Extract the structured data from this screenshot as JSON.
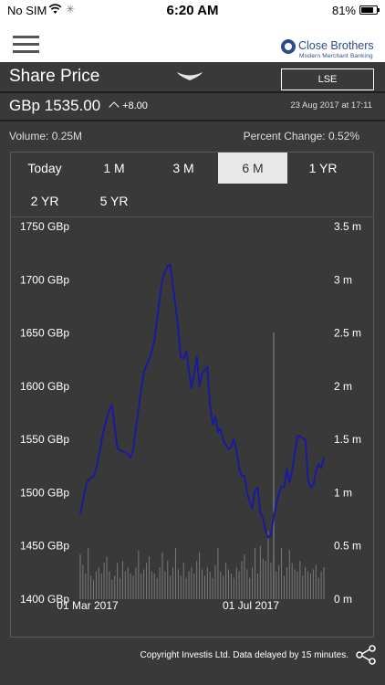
{
  "status_bar": {
    "carrier": "No SIM",
    "wifi_icon": "wifi-icon",
    "activity_icon": "loading-spinner-icon",
    "time": "6:20 AM",
    "battery": "81%",
    "battery_level": 0.81
  },
  "app_bar": {
    "menu_icon": "hamburger-menu-icon",
    "brand_name": "Close Brothers",
    "brand_tagline": "Modern Merchant Banking",
    "brand_color": "#2b4d8c"
  },
  "header": {
    "title": "Share Price",
    "collapse_icon": "chevron-down-icon",
    "exchange": "LSE"
  },
  "quote": {
    "price": "GBp 1535.00",
    "change": "+8.00",
    "change_icon": "chevron-up-icon",
    "timestamp": "23 Aug 2017 at 17:11"
  },
  "stats": {
    "volume": "Volume: 0.25M",
    "percent_change": "Percent Change: 0.52%"
  },
  "range_tabs": [
    {
      "label": "Today",
      "active": false
    },
    {
      "label": "1 M",
      "active": false
    },
    {
      "label": "3 M",
      "active": false
    },
    {
      "label": "6 M",
      "active": true
    },
    {
      "label": "1 YR",
      "active": false
    },
    {
      "label": "2 YR",
      "active": false
    },
    {
      "label": "5 YR",
      "active": false
    }
  ],
  "chart_data": {
    "type": "line",
    "y_tick_labels": [
      "1750 GBp",
      "1700 GBp",
      "1650 GBp",
      "1600 GBp",
      "1550 GBp",
      "1500 GBp",
      "1450 GBp",
      "1400 GBp"
    ],
    "y2_tick_labels": [
      "3.5 m",
      "3 m",
      "2.5 m",
      "2 m",
      "1.5 m",
      "1 m",
      "0.5 m",
      "0 m"
    ],
    "x_tick_labels": [
      "01 Mar 2017",
      "01 Jul 2017"
    ],
    "ylim": [
      1400,
      1750
    ],
    "y2lim": [
      0,
      3.5
    ],
    "grid": false,
    "line_color": "#1a1a9e",
    "volume_color": "#7a7a7a",
    "series": [
      {
        "type": "line",
        "values": [
          1480,
          1492,
          1505,
          1512,
          1514,
          1515,
          1522,
          1535,
          1548,
          1560,
          1570,
          1578,
          1582,
          1562,
          1542,
          1540,
          1539,
          1538,
          1536,
          1533,
          1540,
          1560,
          1578,
          1597,
          1613,
          1620,
          1625,
          1633,
          1643,
          1663,
          1683,
          1700,
          1707,
          1713,
          1714,
          1693,
          1675,
          1653,
          1627,
          1626,
          1633,
          1615,
          1598,
          1612,
          1628,
          1600,
          1612,
          1615,
          1618,
          1582,
          1564,
          1572,
          1557,
          1560,
          1549,
          1545,
          1541,
          1543,
          1550,
          1540,
          1523,
          1515,
          1516,
          1500,
          1491,
          1485,
          1502,
          1505,
          1481,
          1476,
          1464,
          1458,
          1460,
          1477,
          1490,
          1499,
          1506,
          1505,
          1522,
          1510,
          1520,
          1537,
          1553,
          1553,
          1551,
          1550,
          1512,
          1505,
          1507,
          1520,
          1527,
          1523,
          1533
        ]
      }
    ],
    "volume_values": [
      0.42,
      0.32,
      0.24,
      0.48,
      0.22,
      0.18,
      0.26,
      0.3,
      0.24,
      0.34,
      0.4,
      0.26,
      0.18,
      0.22,
      0.34,
      0.2,
      0.36,
      0.26,
      0.3,
      0.24,
      0.22,
      0.3,
      0.46,
      0.24,
      0.28,
      0.34,
      0.4,
      0.26,
      0.24,
      0.2,
      0.3,
      0.44,
      0.26,
      0.36,
      0.22,
      0.3,
      0.48,
      0.28,
      0.22,
      0.34,
      0.2,
      0.26,
      0.3,
      0.24,
      0.36,
      0.44,
      0.28,
      0.22,
      0.3,
      0.26,
      0.2,
      0.32,
      0.48,
      0.26,
      0.22,
      0.34,
      0.28,
      0.24,
      0.2,
      0.3,
      0.26,
      0.36,
      0.42,
      0.28,
      0.2,
      0.3,
      0.48,
      0.24,
      0.5,
      0.38,
      0.36,
      0.64,
      0.34,
      0.4,
      0.26,
      0.32,
      0.48,
      0.22,
      0.3,
      0.46,
      0.34,
      0.28,
      0.26,
      0.36,
      0.22,
      0.3,
      0.26,
      0.24,
      0.28,
      0.32,
      0.2,
      0.26,
      0.3
    ],
    "crosshair": true
  },
  "footer": {
    "copyright": "Copyright Investis Ltd. Data delayed by 15 minutes.",
    "share_icon": "share-icon"
  }
}
